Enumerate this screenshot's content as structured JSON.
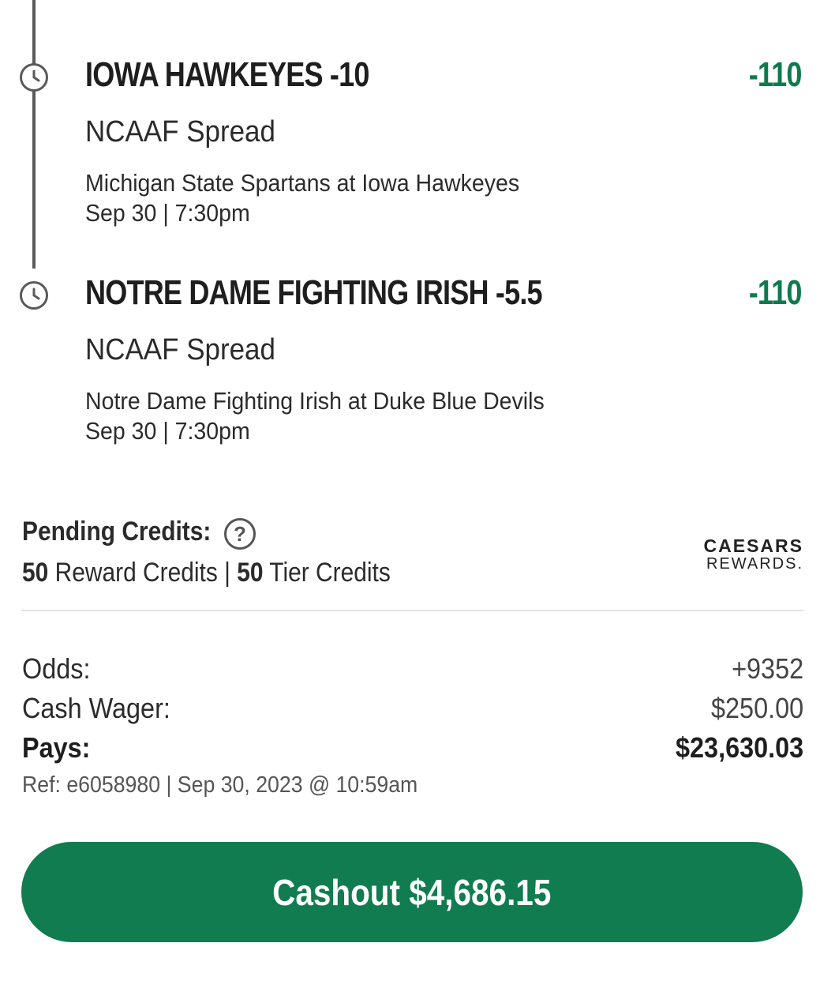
{
  "legs": [
    {
      "title": "IOWA HAWKEYES -10",
      "odds": "-110",
      "market": "NCAAF Spread",
      "event": "Michigan State Spartans at Iowa Hawkeyes",
      "time": "Sep 30 | 7:30pm",
      "icon": "clock-icon"
    },
    {
      "title": "NOTRE DAME FIGHTING IRISH -5.5",
      "odds": "-110",
      "market": "NCAAF Spread",
      "event": "Notre Dame Fighting Irish at Duke Blue Devils",
      "time": "Sep 30 | 7:30pm",
      "icon": "clock-icon"
    }
  ],
  "credits": {
    "label": "Pending Credits:",
    "help_icon": "?",
    "reward_amount": "50",
    "reward_label": "Reward Credits",
    "separator": "|",
    "tier_amount": "50",
    "tier_label": "Tier Credits",
    "logo_line1": "CAESARS",
    "logo_line2": "REWARDS."
  },
  "summary": {
    "odds_label": "Odds:",
    "odds_value": "+9352",
    "wager_label": "Cash Wager:",
    "wager_value": "$250.00",
    "pays_label": "Pays:",
    "pays_value": "$23,630.03",
    "ref": "Ref: e6058980 | Sep 30, 2023 @ 10:59am"
  },
  "cashout": {
    "label": "Cashout $4,686.15"
  },
  "colors": {
    "accent_green": "#107c50",
    "odds_green": "#0f7a4e"
  }
}
